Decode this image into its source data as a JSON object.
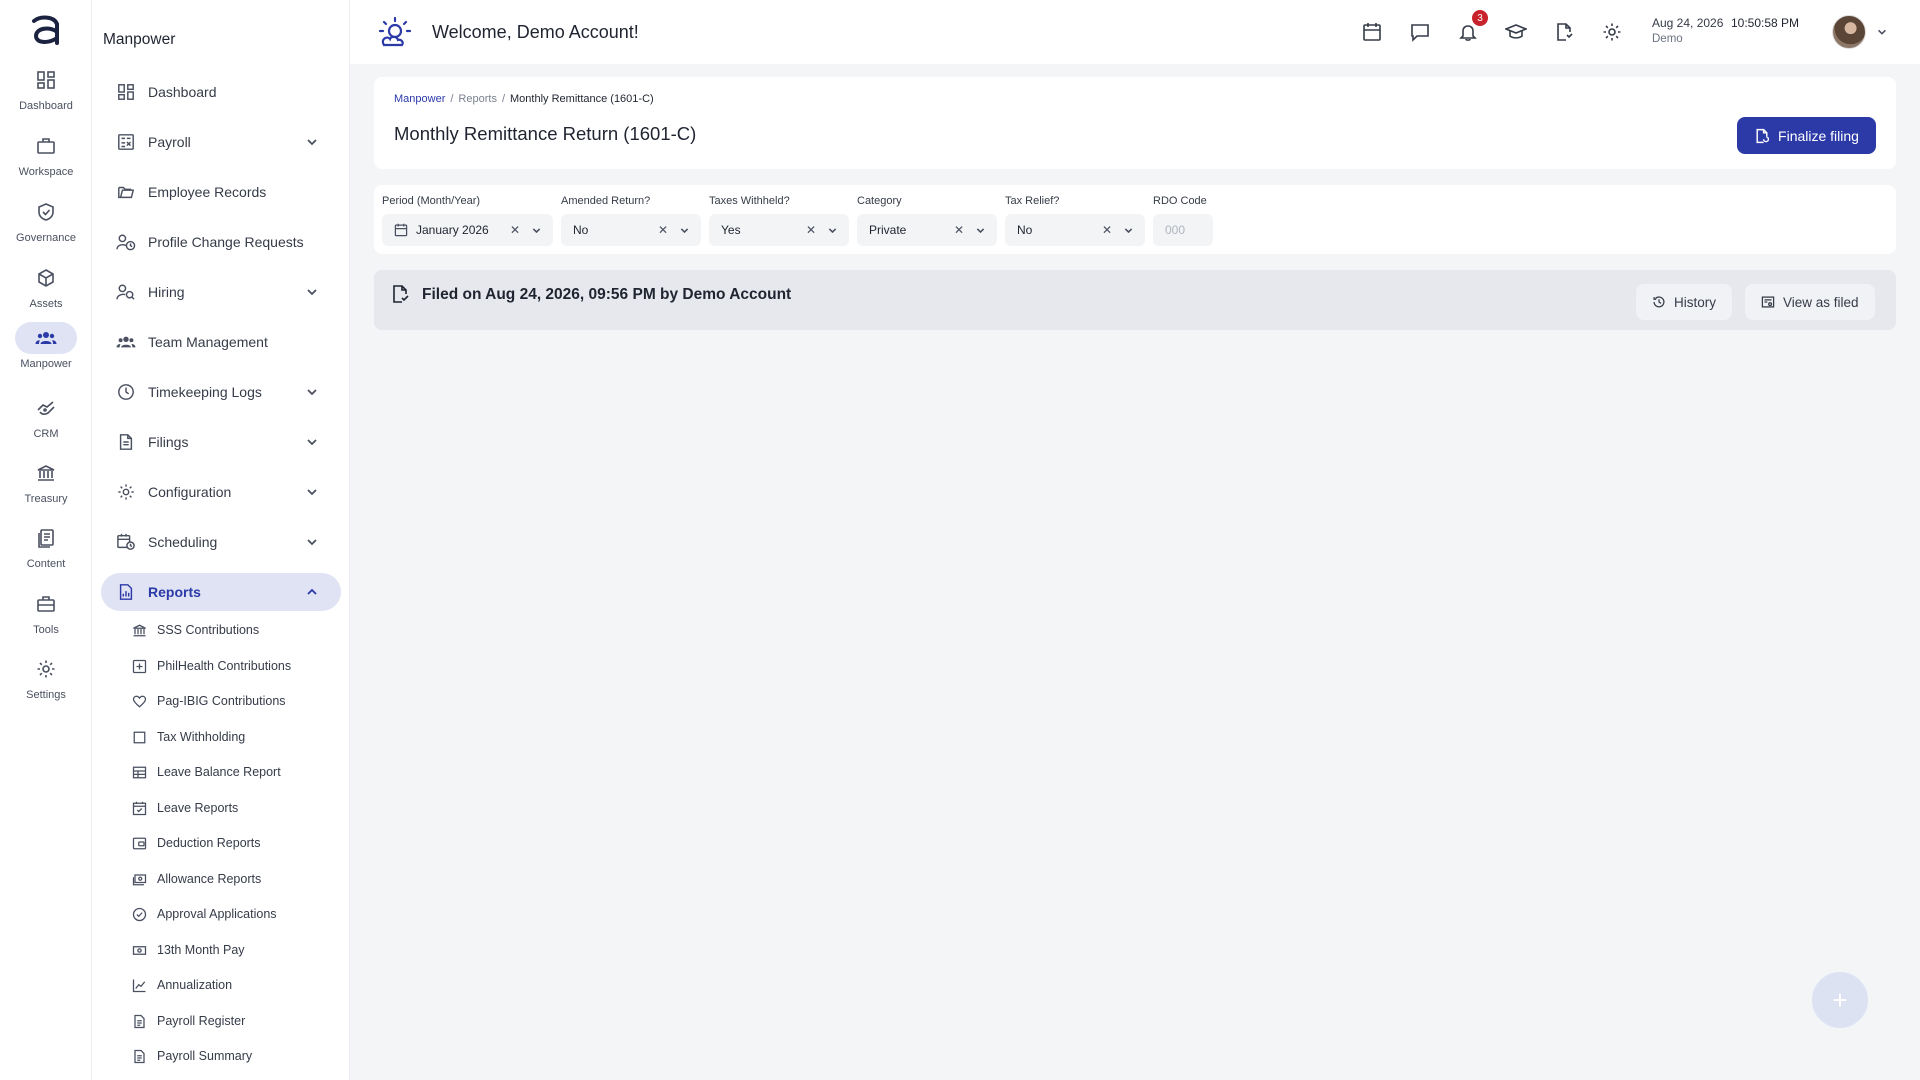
{
  "rail": {
    "items": [
      {
        "label": "Dashboard",
        "icon": "dashboard-icon"
      },
      {
        "label": "Workspace",
        "icon": "briefcase-icon"
      },
      {
        "label": "Governance",
        "icon": "shield-check-icon"
      },
      {
        "label": "Assets",
        "icon": "cube-icon"
      },
      {
        "label": "Manpower",
        "icon": "people-icon",
        "active": true
      },
      {
        "label": "CRM",
        "icon": "handshake-icon"
      },
      {
        "label": "Treasury",
        "icon": "bank-icon"
      },
      {
        "label": "Content",
        "icon": "documents-icon"
      },
      {
        "label": "Tools",
        "icon": "toolbox-icon"
      },
      {
        "label": "Settings",
        "icon": "gear-icon"
      }
    ]
  },
  "sidebar": {
    "title": "Manpower",
    "items": [
      {
        "label": "Dashboard",
        "icon": "dashboard-icon"
      },
      {
        "label": "Payroll",
        "icon": "calculator-icon",
        "expandable": true
      },
      {
        "label": "Employee Records",
        "icon": "folder-open-icon"
      },
      {
        "label": "Profile Change Requests",
        "icon": "user-clock-icon"
      },
      {
        "label": "Hiring",
        "icon": "user-search-icon",
        "expandable": true
      },
      {
        "label": "Team Management",
        "icon": "team-icon"
      },
      {
        "label": "Timekeeping Logs",
        "icon": "clock-icon",
        "expandable": true
      },
      {
        "label": "Filings",
        "icon": "file-icon",
        "expandable": true
      },
      {
        "label": "Configuration",
        "icon": "gear-icon",
        "expandable": true
      },
      {
        "label": "Scheduling",
        "icon": "calendar-clock-icon",
        "expandable": true
      },
      {
        "label": "Reports",
        "icon": "report-icon",
        "expandable": true,
        "active": true
      }
    ],
    "sub_items": [
      {
        "label": "SSS Contributions",
        "icon": "bank-icon"
      },
      {
        "label": "PhilHealth Contributions",
        "icon": "medical-plus-icon"
      },
      {
        "label": "Pag-IBIG Contributions",
        "icon": "heart-icon"
      },
      {
        "label": "Tax Withholding",
        "icon": "square-icon"
      },
      {
        "label": "Leave Balance Report",
        "icon": "table-icon"
      },
      {
        "label": "Leave Reports",
        "icon": "calendar-check-icon"
      },
      {
        "label": "Deduction Reports",
        "icon": "wallet-icon"
      },
      {
        "label": "Allowance Reports",
        "icon": "cash-icon"
      },
      {
        "label": "Approval Applications",
        "icon": "check-circle-icon"
      },
      {
        "label": "13th Month Pay",
        "icon": "money-icon"
      },
      {
        "label": "Annualization",
        "icon": "line-chart-icon"
      },
      {
        "label": "Payroll Register",
        "icon": "file-lines-icon"
      },
      {
        "label": "Payroll Summary",
        "icon": "file-lines-icon"
      }
    ]
  },
  "header": {
    "welcome": "Welcome, Demo Account!",
    "notification_count": "3",
    "date": "Aug 24, 2026",
    "time": "10:50:58 PM",
    "user": "Demo"
  },
  "page": {
    "breadcrumb": [
      "Manpower",
      "Reports",
      "Monthly Remittance (1601-C)"
    ],
    "title": "Monthly Remittance Return (1601-C)",
    "finalize_label": "Finalize filing"
  },
  "filters": {
    "period": {
      "label": "Period (Month/Year)",
      "value": "January 2026"
    },
    "amended": {
      "label": "Amended Return?",
      "value": "No"
    },
    "taxes_withheld": {
      "label": "Taxes Withheld?",
      "value": "Yes"
    },
    "category": {
      "label": "Category",
      "value": "Private"
    },
    "tax_relief": {
      "label": "Tax Relief?",
      "value": "No"
    },
    "rdo": {
      "label": "RDO Code",
      "value": "",
      "placeholder": "000"
    }
  },
  "filed": {
    "text": "Filed on Aug 24, 2026, 09:56 PM by Demo Account",
    "history_label": "History",
    "view_label": "View as filed"
  },
  "fab": {
    "label": "+"
  },
  "colors": {
    "accent": "#2c3aa8",
    "active_bg": "#dfe3f4",
    "badge": "#c8232c"
  }
}
